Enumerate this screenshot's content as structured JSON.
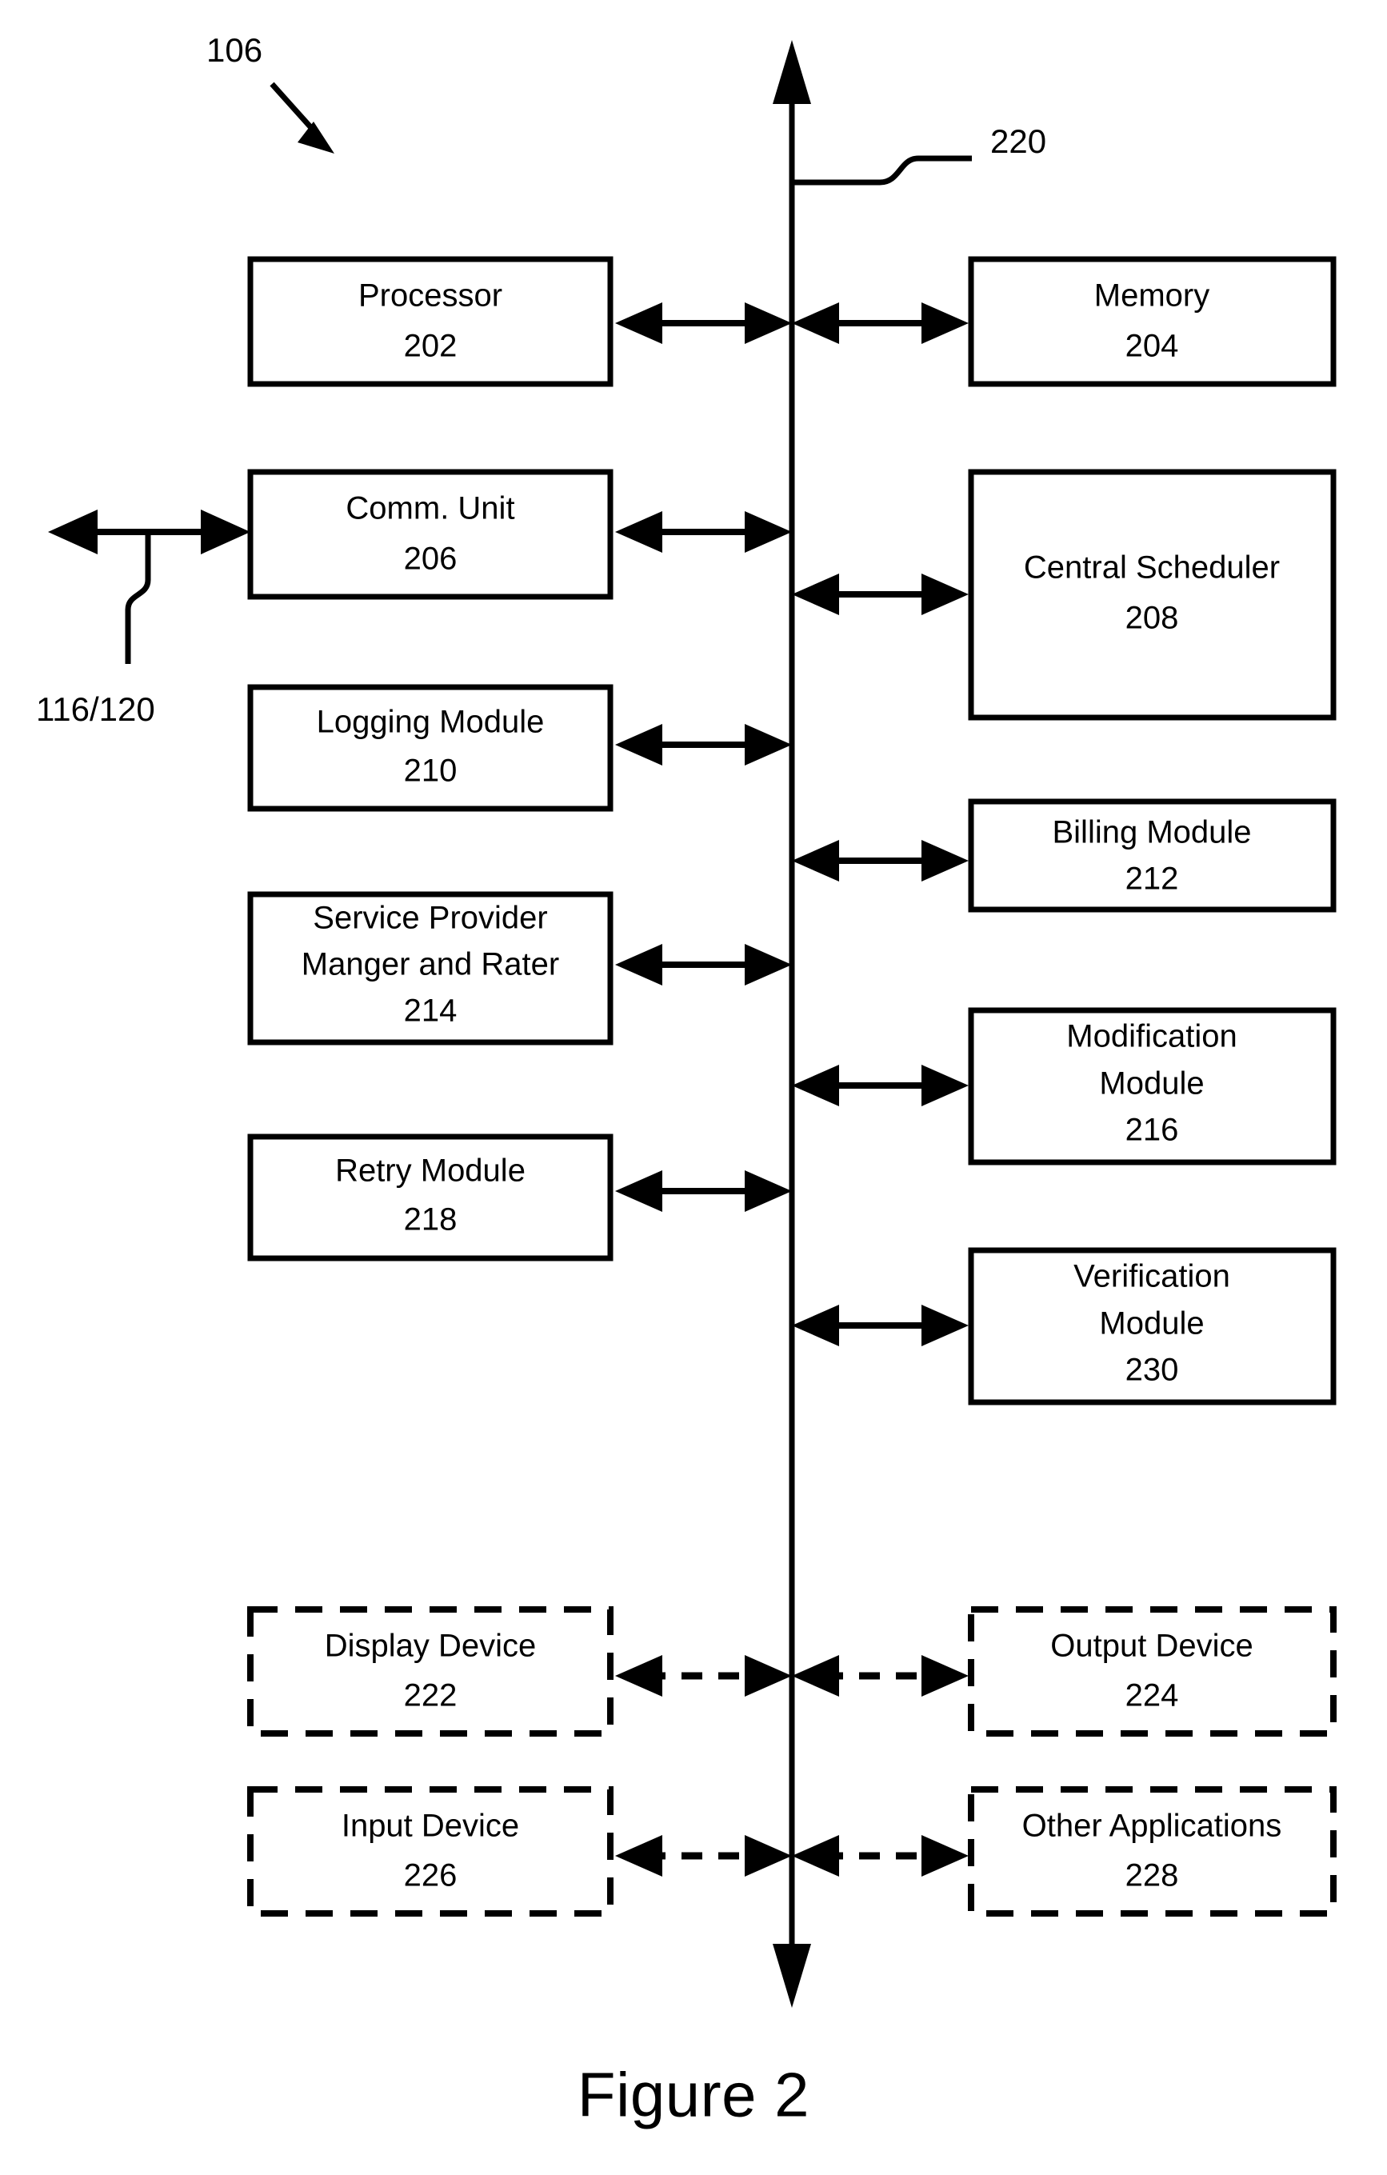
{
  "figure": {
    "caption": "Figure 2",
    "system_ref": "106",
    "bus_ref": "220",
    "external_link_ref": "116/120"
  },
  "bus": {
    "name": "system-bus",
    "label": "220"
  },
  "left_column": [
    {
      "id": "processor",
      "lines": [
        "Processor"
      ],
      "ref": "202"
    },
    {
      "id": "comm-unit",
      "lines": [
        "Comm. Unit"
      ],
      "ref": "206"
    },
    {
      "id": "logging-module",
      "lines": [
        "Logging Module"
      ],
      "ref": "210"
    },
    {
      "id": "service-provider",
      "lines": [
        "Service Provider",
        "Manger and Rater"
      ],
      "ref": "214"
    },
    {
      "id": "retry-module",
      "lines": [
        "Retry Module"
      ],
      "ref": "218"
    }
  ],
  "right_column": [
    {
      "id": "memory",
      "lines": [
        "Memory"
      ],
      "ref": "204"
    },
    {
      "id": "central-scheduler",
      "lines": [
        "Central Scheduler"
      ],
      "ref": "208"
    },
    {
      "id": "billing-module",
      "lines": [
        "Billing Module"
      ],
      "ref": "212"
    },
    {
      "id": "modification-module",
      "lines": [
        "Modification",
        "Module"
      ],
      "ref": "216"
    },
    {
      "id": "verification-module",
      "lines": [
        "Verification",
        "Module"
      ],
      "ref": "230"
    }
  ],
  "optional_left_column": [
    {
      "id": "display-device",
      "lines": [
        "Display Device"
      ],
      "ref": "222"
    },
    {
      "id": "input-device",
      "lines": [
        "Input Device"
      ],
      "ref": "226"
    }
  ],
  "optional_right_column": [
    {
      "id": "output-device",
      "lines": [
        "Output Device"
      ],
      "ref": "224"
    },
    {
      "id": "other-applications",
      "lines": [
        "Other Applications"
      ],
      "ref": "228"
    }
  ],
  "text": {
    "processor_title": "Processor",
    "processor_ref": "202",
    "memory_title": "Memory",
    "memory_ref": "204",
    "comm_unit_title": "Comm. Unit",
    "comm_unit_ref": "206",
    "central_scheduler_title": "Central Scheduler",
    "central_scheduler_ref": "208",
    "logging_module_title": "Logging Module",
    "logging_module_ref": "210",
    "billing_module_title": "Billing Module",
    "billing_module_ref": "212",
    "service_provider_line1": "Service Provider",
    "service_provider_line2": "Manger and Rater",
    "service_provider_ref": "214",
    "modification_line1": "Modification",
    "modification_line2": "Module",
    "modification_ref": "216",
    "retry_module_title": "Retry Module",
    "retry_module_ref": "218",
    "verification_line1": "Verification",
    "verification_line2": "Module",
    "verification_ref": "230",
    "display_device_title": "Display Device",
    "display_device_ref": "222",
    "output_device_title": "Output Device",
    "output_device_ref": "224",
    "input_device_title": "Input Device",
    "input_device_ref": "226",
    "other_applications_title": "Other Applications",
    "other_applications_ref": "228",
    "system_ref": "106",
    "bus_ref": "220",
    "external_link_ref": "116/120",
    "caption": "Figure 2"
  },
  "colors": {
    "stroke": "#000000",
    "background": "#ffffff"
  }
}
